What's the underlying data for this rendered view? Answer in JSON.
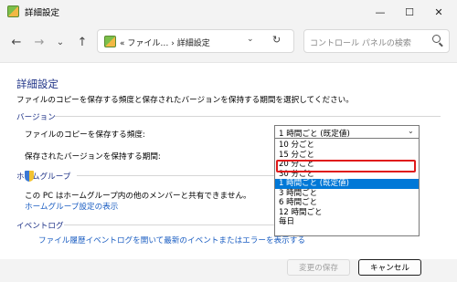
{
  "window": {
    "title": "詳細設定",
    "minimize": "—",
    "maximize": "☐",
    "close": "✕"
  },
  "nav": {
    "back": "←",
    "forward": "→",
    "dropdown": "⌄",
    "up": "↑",
    "address": "« ファイル…  ›  詳細設定",
    "address_dropdown": "⌄",
    "refresh": "↻",
    "search_placeholder": "コントロール パネルの検索"
  },
  "content": {
    "heading": "詳細設定",
    "description": "ファイルのコピーを保存する頻度と保存されたバージョンを保持する期間を選択してください。",
    "versions": {
      "title": "バージョン",
      "save_frequency_label": "ファイルのコピーを保存する頻度:",
      "save_frequency_value": "1 時間ごと (既定値)",
      "keep_period_label": "保存されたバージョンを保持する期間:"
    },
    "homegroup": {
      "title": "ホームグループ",
      "text": "この PC はホームグループ内の他のメンバーと共有できません。",
      "link": "ホームグループ設定の表示"
    },
    "eventlog": {
      "title": "イベントログ",
      "link": "ファイル履歴イベントログを開いて最新のイベントまたはエラーを表示する"
    }
  },
  "dropdown": {
    "options": [
      "10 分ごと",
      "15 分ごと",
      "20 分ごと",
      "30 分ごと",
      "1 時間ごと (既定値)",
      "3 時間ごと",
      "6 時間ごと",
      "12 時間ごと",
      "毎日"
    ],
    "selected_index": 4,
    "highlighted_index": 2
  },
  "footer": {
    "save_button": "変更の保存",
    "cancel_button": "キャンセル"
  },
  "colors": {
    "heading": "#1e3287",
    "link": "#1a5dc2",
    "selection": "#0078d7",
    "highlight_box": "#e01b1b"
  }
}
